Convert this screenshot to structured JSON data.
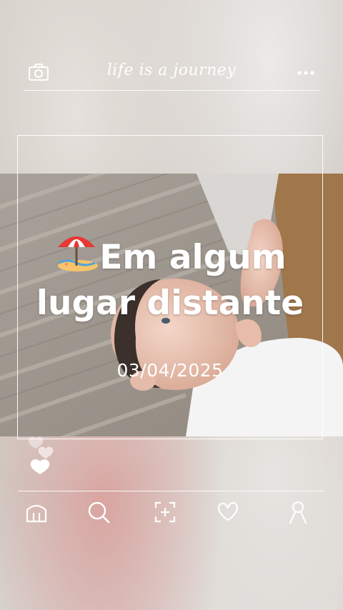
{
  "header": {
    "title": "life is a journey",
    "camera_icon": "camera-icon",
    "menu_icon": "more-dots-icon"
  },
  "post": {
    "headline_line1": "Em algum",
    "headline_line2": "lugar distante",
    "headline_emoji": "beach-umbrella-emoji",
    "date": "03/04/2025"
  },
  "reactions": {
    "icon": "floating-hearts-icon"
  },
  "bottom_nav": [
    {
      "name": "home",
      "icon": "home-icon"
    },
    {
      "name": "search",
      "icon": "search-icon"
    },
    {
      "name": "add",
      "icon": "add-post-icon"
    },
    {
      "name": "likes",
      "icon": "heart-icon"
    },
    {
      "name": "profile",
      "icon": "profile-icon"
    }
  ],
  "colors": {
    "foreground": "#ffffff",
    "umbrella_red": "#e53935",
    "sand": "#f6c46b"
  }
}
